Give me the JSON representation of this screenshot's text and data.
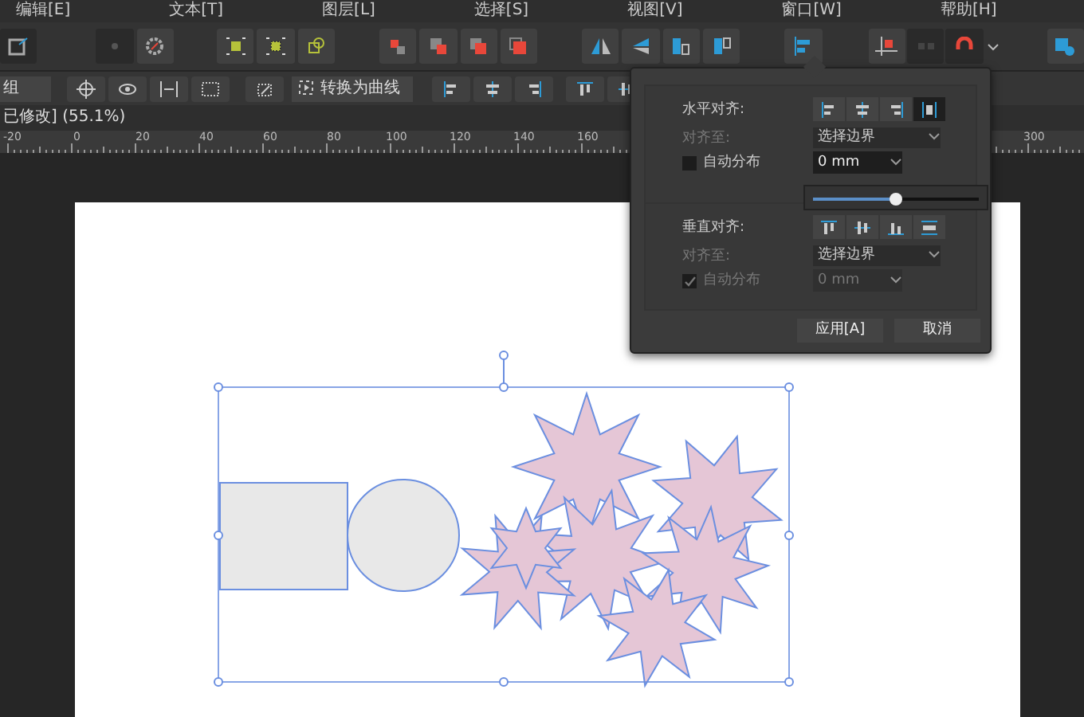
{
  "menu": [
    {
      "label": "编辑[E]"
    },
    {
      "label": "文本[T]"
    },
    {
      "label": "图层[L]"
    },
    {
      "label": "选择[S]"
    },
    {
      "label": "视图[V]"
    },
    {
      "label": "窗口[W]"
    },
    {
      "label": "帮助[H]"
    }
  ],
  "context_toolbar": {
    "field_value": "组",
    "convert_button": "转换为曲线"
  },
  "document_tab": {
    "title": "已修改] (55.1%)"
  },
  "ruler": {
    "labels": [
      "-20",
      "0",
      "20",
      "40",
      "60",
      "80",
      "100",
      "120",
      "140",
      "160",
      "300"
    ]
  },
  "align_popover": {
    "horizontal": {
      "label": "水平对齐:",
      "modes": [
        {
          "selected": false
        },
        {
          "selected": false
        },
        {
          "selected": false
        },
        {
          "selected": true
        }
      ],
      "align_to": {
        "label": "对齐至:",
        "value": "选择边界",
        "disabled": true
      },
      "auto_distribute": {
        "label": "自动分布",
        "checked": false,
        "disabled": false
      },
      "spacing": {
        "value": "0 mm",
        "disabled": false
      },
      "slider": {
        "level": 0.5
      }
    },
    "vertical": {
      "label": "垂直对齐:",
      "modes": [
        {
          "selected": false
        },
        {
          "selected": false
        },
        {
          "selected": false
        },
        {
          "selected": false
        }
      ],
      "align_to": {
        "label": "对齐至:",
        "value": "选择边界",
        "disabled": true
      },
      "auto_distribute": {
        "label": "自动分布",
        "checked": true,
        "disabled": true
      },
      "spacing": {
        "value": "0 mm",
        "disabled": true
      }
    },
    "buttons": [
      "应用[A]",
      "取消"
    ]
  }
}
